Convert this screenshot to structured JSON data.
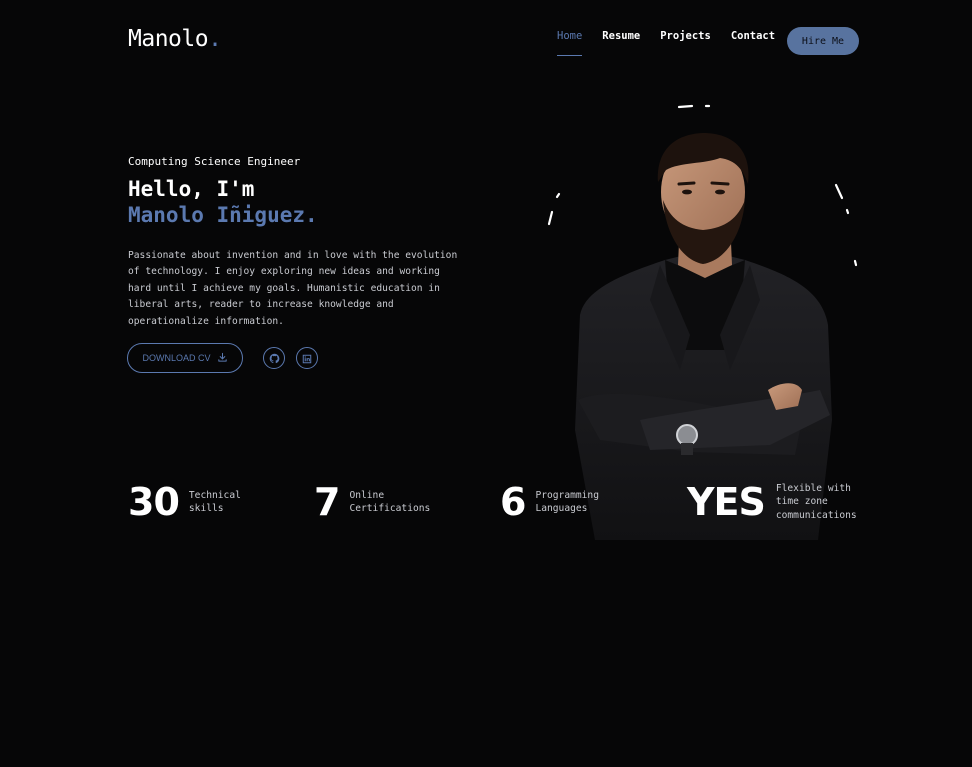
{
  "header": {
    "logo": "Manolo",
    "logo_dot": ".",
    "nav": [
      {
        "label": "Home",
        "active": true
      },
      {
        "label": "Resume",
        "active": false
      },
      {
        "label": "Projects",
        "active": false
      },
      {
        "label": "Contact",
        "active": false
      }
    ],
    "cta_label": "Hire Me"
  },
  "hero": {
    "subtitle": "Computing Science Engineer",
    "greeting": "Hello, I'm",
    "name": "Manolo Iñiguez.",
    "bio_lines": [
      "Passionate about invention and in love with the evolution",
      "of technology. I enjoy exploring new ideas and working",
      "hard until I achieve my goals. Humanistic education in",
      "liberal arts, reader to increase knowledge and",
      "operationalize information."
    ],
    "download_label": "DOWNLOAD CV",
    "icons": {
      "download": "download-icon",
      "github": "github-icon",
      "linkedin": "linkedin-icon"
    }
  },
  "stats": [
    {
      "value": "30",
      "label_lines": [
        "Technical",
        "skills"
      ]
    },
    {
      "value": "7",
      "label_lines": [
        "Online",
        "Certifications"
      ]
    },
    {
      "value": "6",
      "label_lines": [
        "Programming",
        "Languages"
      ]
    },
    {
      "value": "YES",
      "label_lines": [
        "Flexible with",
        "time zone",
        "communications"
      ]
    }
  ],
  "colors": {
    "accent": "#5b79b0",
    "background": "#060607",
    "text": "#ffffff",
    "muted": "#c9cbd1"
  }
}
